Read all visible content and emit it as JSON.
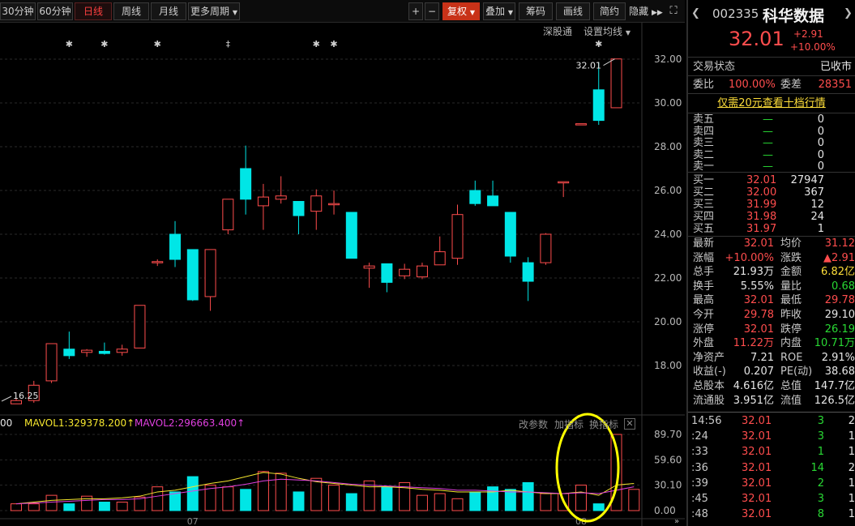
{
  "toolbar": {
    "periods": [
      "30分钟",
      "60分钟",
      "日线",
      "周线",
      "月线",
      "更多周期"
    ],
    "active_period": "日线",
    "zoom_in": "+",
    "zoom_out": "−",
    "right_buttons": [
      "复权",
      "叠加",
      "筹码",
      "画线",
      "简约",
      "隐藏"
    ],
    "sub_links": [
      "深股通",
      "设置均线"
    ]
  },
  "stock": {
    "code": "002335",
    "name": "科华数据",
    "price": "32.01",
    "change": "+2.91",
    "change_pct": "+10.00%"
  },
  "quote_panel": {
    "status_label": "交易状态",
    "status_value": "已收市",
    "weibi_label": "委比",
    "weibi_value": "100.00%",
    "weicha_label": "委差",
    "weicha_value": "28351",
    "promo_link": "仅需20元查看十档行情",
    "sells": [
      {
        "label": "卖五",
        "price": "—",
        "vol": "0"
      },
      {
        "label": "卖四",
        "price": "—",
        "vol": "0"
      },
      {
        "label": "卖三",
        "price": "—",
        "vol": "0"
      },
      {
        "label": "卖二",
        "price": "—",
        "vol": "0"
      },
      {
        "label": "卖一",
        "price": "—",
        "vol": "0"
      }
    ],
    "buys": [
      {
        "label": "买一",
        "price": "32.01",
        "vol": "27947"
      },
      {
        "label": "买二",
        "price": "32.00",
        "vol": "367"
      },
      {
        "label": "买三",
        "price": "31.99",
        "vol": "12"
      },
      {
        "label": "买四",
        "price": "31.98",
        "vol": "24"
      },
      {
        "label": "买五",
        "price": "31.97",
        "vol": "1"
      }
    ],
    "stats": [
      {
        "l1": "最新",
        "v1": "32.01",
        "c1": "red",
        "l2": "均价",
        "v2": "31.12",
        "c2": "red"
      },
      {
        "l1": "涨幅",
        "v1": "+10.00%",
        "c1": "red",
        "l2": "涨跌",
        "v2": "▲2.91",
        "c2": "red"
      },
      {
        "l1": "总手",
        "v1": "21.93万",
        "c1": "white",
        "l2": "金额",
        "v2": "6.82亿",
        "c2": "yel"
      },
      {
        "l1": "换手",
        "v1": "5.55%",
        "c1": "white",
        "l2": "量比",
        "v2": "0.68",
        "c2": "green"
      },
      {
        "l1": "最高",
        "v1": "32.01",
        "c1": "red",
        "l2": "最低",
        "v2": "29.78",
        "c2": "red"
      },
      {
        "l1": "今开",
        "v1": "29.78",
        "c1": "red",
        "l2": "昨收",
        "v2": "29.10",
        "c2": "white"
      },
      {
        "l1": "涨停",
        "v1": "32.01",
        "c1": "red",
        "l2": "跌停",
        "v2": "26.19",
        "c2": "green"
      },
      {
        "l1": "外盘",
        "v1": "11.22万",
        "c1": "red",
        "l2": "内盘",
        "v2": "10.71万",
        "c2": "green"
      },
      {
        "l1": "净资产",
        "v1": "7.21",
        "c1": "white",
        "l2": "ROE",
        "v2": "2.91%",
        "c2": "white"
      },
      {
        "l1": "收益(-)",
        "v1": "0.207",
        "c1": "white",
        "l2": "PE(动)",
        "v2": "38.68",
        "c2": "white"
      },
      {
        "l1": "总股本",
        "v1": "4.616亿",
        "c1": "white",
        "l2": "总值",
        "v2": "147.7亿",
        "c2": "white"
      },
      {
        "l1": "流通股",
        "v1": "3.951亿",
        "c1": "white",
        "l2": "流值",
        "v2": "126.5亿",
        "c2": "white"
      }
    ],
    "ticks": [
      {
        "time": "14:56",
        "price": "32.01",
        "vol": "3",
        "n": "2"
      },
      {
        "time": ":24",
        "price": "32.01",
        "vol": "3",
        "n": "1"
      },
      {
        "time": ":33",
        "price": "32.01",
        "vol": "1",
        "n": "1"
      },
      {
        "time": ":36",
        "price": "32.01",
        "vol": "14",
        "n": "2"
      },
      {
        "time": ":39",
        "price": "32.01",
        "vol": "2",
        "n": "1"
      },
      {
        "time": ":45",
        "price": "32.01",
        "vol": "3",
        "n": "1"
      },
      {
        "time": ":48",
        "price": "32.01",
        "vol": "8",
        "n": "1"
      }
    ]
  },
  "volume_legend": {
    "prefix": "00",
    "mavol1": "MAVOL1:329378.200",
    "mavol2": "MAVOL2:296663.400",
    "tools": [
      "改参数",
      "加指标",
      "换指标"
    ],
    "axis_labels": [
      "89.70",
      "59.60",
      "30.10",
      "0.00"
    ]
  },
  "colors": {
    "up": "#ff4d4d",
    "down": "#00e6e6",
    "mavol1": "#f5e62e",
    "mavol2": "#e040e0",
    "highlight": "#ffff00"
  },
  "chart_data": {
    "type": "candlestick",
    "price_axis": {
      "ticks": [
        "32.00",
        "30.00",
        "28.00",
        "26.00",
        "24.00",
        "22.00",
        "20.00",
        "18.00"
      ],
      "ylim": [
        16.0,
        33.0
      ]
    },
    "annotations": {
      "high_label": "32.01",
      "low_label": "16.25"
    },
    "x_tick_labels": [
      "07",
      "08"
    ],
    "candles": [
      {
        "o": 16.25,
        "h": 16.5,
        "l": 16.25,
        "c": 16.4
      },
      {
        "o": 16.4,
        "h": 17.3,
        "l": 16.3,
        "c": 17.1
      },
      {
        "o": 17.3,
        "h": 19.0,
        "l": 17.2,
        "c": 19.0
      },
      {
        "o": 18.75,
        "h": 19.55,
        "l": 18.3,
        "c": 18.45
      },
      {
        "o": 18.6,
        "h": 18.75,
        "l": 18.4,
        "c": 18.7
      },
      {
        "o": 18.65,
        "h": 19.05,
        "l": 18.5,
        "c": 18.55
      },
      {
        "o": 18.6,
        "h": 18.95,
        "l": 18.45,
        "c": 18.75
      },
      {
        "o": 18.8,
        "h": 20.75,
        "l": 18.8,
        "c": 20.75
      },
      {
        "o": 22.7,
        "h": 22.85,
        "l": 22.55,
        "c": 22.75
      },
      {
        "o": 24.0,
        "h": 24.6,
        "l": 22.5,
        "c": 22.85
      },
      {
        "o": 23.3,
        "h": 23.3,
        "l": 20.95,
        "c": 21.0
      },
      {
        "o": 21.15,
        "h": 23.3,
        "l": 20.5,
        "c": 23.3
      },
      {
        "o": 24.2,
        "h": 25.6,
        "l": 24.0,
        "c": 25.6
      },
      {
        "o": 27.0,
        "h": 28.05,
        "l": 24.9,
        "c": 25.6
      },
      {
        "o": 25.3,
        "h": 26.3,
        "l": 24.2,
        "c": 25.7
      },
      {
        "o": 25.6,
        "h": 26.65,
        "l": 25.4,
        "c": 25.75
      },
      {
        "o": 25.5,
        "h": 25.5,
        "l": 24.0,
        "c": 24.85
      },
      {
        "o": 25.05,
        "h": 26.05,
        "l": 24.2,
        "c": 25.75
      },
      {
        "o": 25.4,
        "h": 26.0,
        "l": 24.9,
        "c": 25.4
      },
      {
        "o": 25.0,
        "h": 25.0,
        "l": 22.9,
        "c": 22.9
      },
      {
        "o": 22.45,
        "h": 22.7,
        "l": 21.55,
        "c": 22.55
      },
      {
        "o": 22.65,
        "h": 22.65,
        "l": 21.35,
        "c": 21.8
      },
      {
        "o": 22.1,
        "h": 22.65,
        "l": 21.95,
        "c": 22.4
      },
      {
        "o": 22.05,
        "h": 22.7,
        "l": 21.95,
        "c": 22.55
      },
      {
        "o": 22.6,
        "h": 23.9,
        "l": 22.6,
        "c": 23.2
      },
      {
        "o": 22.9,
        "h": 25.35,
        "l": 22.6,
        "c": 24.9
      },
      {
        "o": 26.0,
        "h": 26.45,
        "l": 25.3,
        "c": 25.4
      },
      {
        "o": 25.75,
        "h": 26.45,
        "l": 25.4,
        "c": 25.3
      },
      {
        "o": 25.0,
        "h": 25.0,
        "l": 22.7,
        "c": 23.0
      },
      {
        "o": 22.7,
        "h": 22.95,
        "l": 20.95,
        "c": 21.85
      },
      {
        "o": 22.7,
        "h": 24.05,
        "l": 22.6,
        "c": 24.0
      },
      {
        "o": 26.4,
        "h": 26.4,
        "l": 25.7,
        "c": 26.4
      },
      {
        "o": 29.05,
        "h": 29.05,
        "l": 29.05,
        "c": 29.05
      },
      {
        "o": 30.6,
        "h": 31.85,
        "l": 29.0,
        "c": 29.2
      },
      {
        "o": 29.78,
        "h": 32.01,
        "l": 29.78,
        "c": 32.01
      }
    ],
    "volume": {
      "ylim": [
        0,
        100
      ],
      "values": [
        8,
        8,
        18,
        8,
        17,
        10,
        10,
        16,
        28,
        22,
        40,
        30,
        28,
        25,
        46,
        44,
        22,
        38,
        30,
        20,
        35,
        28,
        33,
        18,
        20,
        14,
        22,
        28,
        25,
        33,
        20,
        20,
        30,
        8,
        89.7,
        25
      ],
      "mavol1": [
        8,
        10,
        12,
        13,
        14,
        14,
        15,
        17,
        22,
        24,
        28,
        32,
        35,
        40,
        45,
        43,
        38,
        34,
        32,
        30,
        28,
        28,
        27,
        25,
        24,
        22,
        22,
        22,
        24,
        22,
        20,
        20,
        22,
        18,
        30,
        32
      ],
      "mavol2": [
        8,
        9,
        10,
        11,
        12,
        13,
        13,
        14,
        17,
        20,
        23,
        26,
        28,
        31,
        35,
        37,
        36,
        35,
        33,
        31,
        30,
        29,
        28,
        27,
        26,
        24,
        24,
        23,
        22,
        22,
        21,
        20,
        21,
        20,
        24,
        28
      ]
    }
  }
}
